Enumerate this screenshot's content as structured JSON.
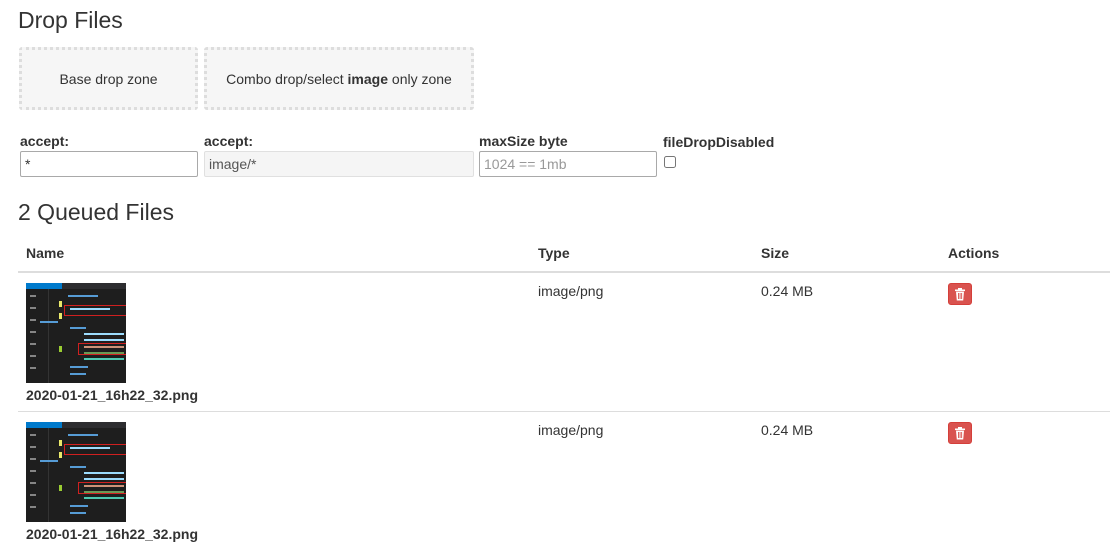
{
  "drop_section": {
    "title": "Drop Files",
    "base_zone_label": "Base drop zone",
    "combo_zone_prefix": "Combo drop/select ",
    "combo_zone_bold": "image",
    "combo_zone_suffix": " only zone"
  },
  "options": {
    "accept1": {
      "label": "accept:",
      "value": "*"
    },
    "accept2": {
      "label": "accept:",
      "value": "image/*"
    },
    "max_size": {
      "label": "maxSize byte",
      "placeholder": "1024 == 1mb"
    },
    "file_drop_disabled": {
      "label": "fileDropDisabled",
      "checked": false
    }
  },
  "queue": {
    "title": "2 Queued Files",
    "columns": [
      "Name",
      "Type",
      "Size",
      "Actions"
    ],
    "files": [
      {
        "name": "2020-01-21_16h22_32.png",
        "type": "image/png",
        "size": "0.24 MB"
      },
      {
        "name": "2020-01-21_16h22_32.png",
        "type": "image/png",
        "size": "0.24 MB"
      }
    ]
  },
  "icons": {
    "delete": "trash-icon"
  },
  "colors": {
    "delete_button": "#d9534f",
    "dropzone_border": "#dddddd",
    "dropzone_bg": "#f6f6f6"
  }
}
